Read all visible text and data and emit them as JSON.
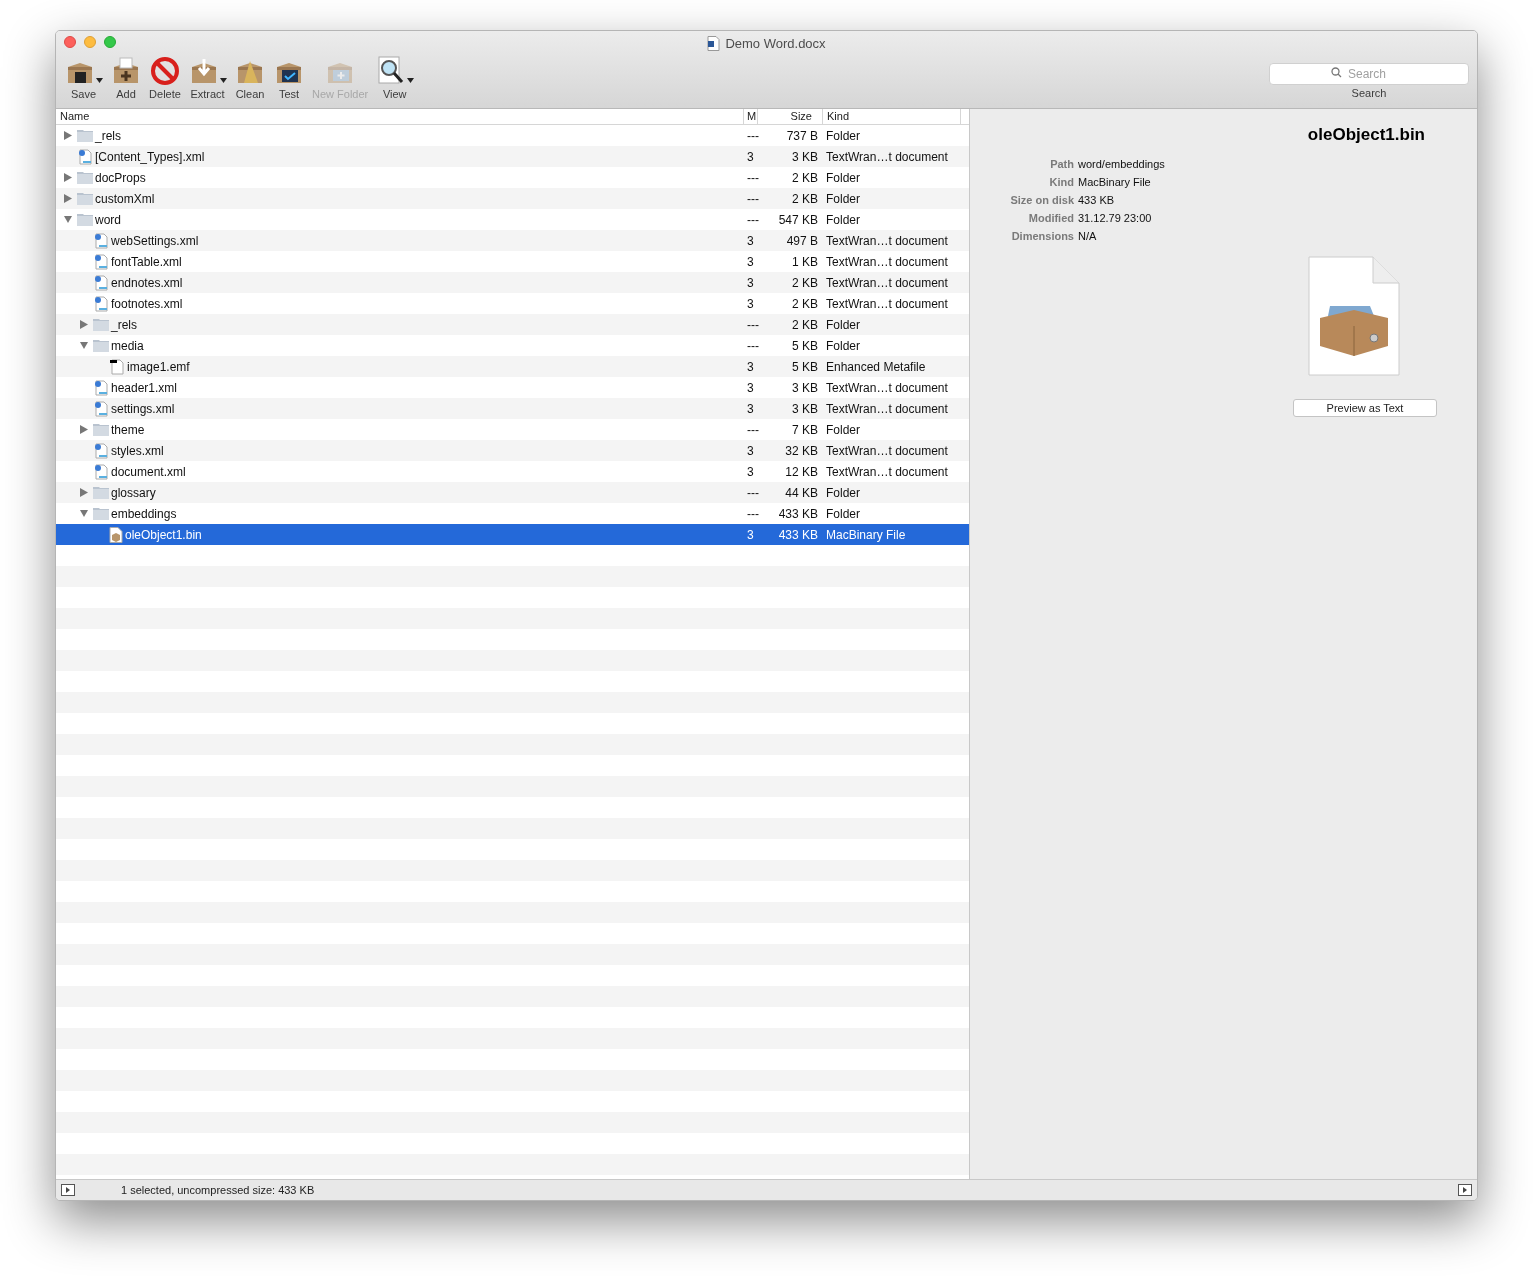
{
  "window": {
    "title": "Demo Word.docx"
  },
  "toolbar": [
    {
      "label": "Save",
      "kind": "save",
      "menu": true,
      "disabled": false
    },
    {
      "label": "Add",
      "kind": "add",
      "menu": false,
      "disabled": false
    },
    {
      "label": "Delete",
      "kind": "delete",
      "menu": false,
      "disabled": false
    },
    {
      "label": "Extract",
      "kind": "extract",
      "menu": true,
      "disabled": false
    },
    {
      "label": "Clean",
      "kind": "clean",
      "menu": false,
      "disabled": false
    },
    {
      "label": "Test",
      "kind": "test",
      "menu": false,
      "disabled": false
    },
    {
      "label": "New Folder",
      "kind": "newfolder",
      "menu": false,
      "disabled": true
    },
    {
      "label": "View",
      "kind": "view",
      "menu": true,
      "disabled": false
    }
  ],
  "search": {
    "placeholder": "Search",
    "label": "Search"
  },
  "table": {
    "columns": [
      "Name",
      "M",
      "Size",
      "Kind"
    ],
    "rows": [
      {
        "name": "_rels",
        "kind": "folder",
        "m": "---",
        "size": "737 B",
        "type": "Folder",
        "expanded": false,
        "selected": false
      },
      {
        "name": "[Content_Types].xml",
        "kind": "xml",
        "m": "3",
        "size": "3 KB",
        "type": "TextWran…t document",
        "selected": false
      },
      {
        "name": "docProps",
        "kind": "folder",
        "m": "---",
        "size": "2 KB",
        "type": "Folder",
        "expanded": false,
        "selected": false
      },
      {
        "name": "customXml",
        "kind": "folder",
        "m": "---",
        "size": "2 KB",
        "type": "Folder",
        "expanded": false,
        "selected": false
      },
      {
        "name": "word",
        "kind": "folder",
        "m": "---",
        "size": "547 KB",
        "type": "Folder",
        "expanded": true,
        "selected": false,
        "children": [
          {
            "name": "webSettings.xml",
            "kind": "xml",
            "m": "3",
            "size": "497 B",
            "type": "TextWran…t document",
            "selected": false
          },
          {
            "name": "fontTable.xml",
            "kind": "xml",
            "m": "3",
            "size": "1 KB",
            "type": "TextWran…t document",
            "selected": false
          },
          {
            "name": "endnotes.xml",
            "kind": "xml",
            "m": "3",
            "size": "2 KB",
            "type": "TextWran…t document",
            "selected": false
          },
          {
            "name": "footnotes.xml",
            "kind": "xml",
            "m": "3",
            "size": "2 KB",
            "type": "TextWran…t document",
            "selected": false
          },
          {
            "name": "_rels",
            "kind": "folder",
            "m": "---",
            "size": "2 KB",
            "type": "Folder",
            "expanded": false,
            "selected": false
          },
          {
            "name": "media",
            "kind": "folder",
            "m": "---",
            "size": "5 KB",
            "type": "Folder",
            "expanded": true,
            "selected": false,
            "children": [
              {
                "name": "image1.emf",
                "kind": "emf",
                "m": "3",
                "size": "5 KB",
                "type": "Enhanced Metafile",
                "selected": false
              }
            ]
          },
          {
            "name": "header1.xml",
            "kind": "xml",
            "m": "3",
            "size": "3 KB",
            "type": "TextWran…t document",
            "selected": false
          },
          {
            "name": "settings.xml",
            "kind": "xml",
            "m": "3",
            "size": "3 KB",
            "type": "TextWran…t document",
            "selected": false
          },
          {
            "name": "theme",
            "kind": "folder",
            "m": "---",
            "size": "7 KB",
            "type": "Folder",
            "expanded": false,
            "selected": false
          },
          {
            "name": "styles.xml",
            "kind": "xml",
            "m": "3",
            "size": "32 KB",
            "type": "TextWran…t document",
            "selected": false
          },
          {
            "name": "document.xml",
            "kind": "xml",
            "m": "3",
            "size": "12 KB",
            "type": "TextWran…t document",
            "selected": false
          },
          {
            "name": "glossary",
            "kind": "folder",
            "m": "---",
            "size": "44 KB",
            "type": "Folder",
            "expanded": false,
            "selected": false
          },
          {
            "name": "embeddings",
            "kind": "folder",
            "m": "---",
            "size": "433 KB",
            "type": "Folder",
            "expanded": true,
            "selected": false,
            "children": [
              {
                "name": "oleObject1.bin",
                "kind": "bin",
                "m": "3",
                "size": "433 KB",
                "type": "MacBinary File",
                "selected": true
              }
            ]
          }
        ]
      }
    ]
  },
  "inspector": {
    "title": "oleObject1.bin",
    "fields": [
      {
        "label": "Path",
        "value": "word/embeddings"
      },
      {
        "label": "Kind",
        "value": "MacBinary File"
      },
      {
        "label": "Size on disk",
        "value": "433 KB"
      },
      {
        "label": "Modified",
        "value": "31.12.79 23:00"
      },
      {
        "label": "Dimensions",
        "value": "N/A"
      }
    ],
    "button": "Preview as Text"
  },
  "status_bar": {
    "text": "1 selected, uncompressed size: 433 KB"
  }
}
